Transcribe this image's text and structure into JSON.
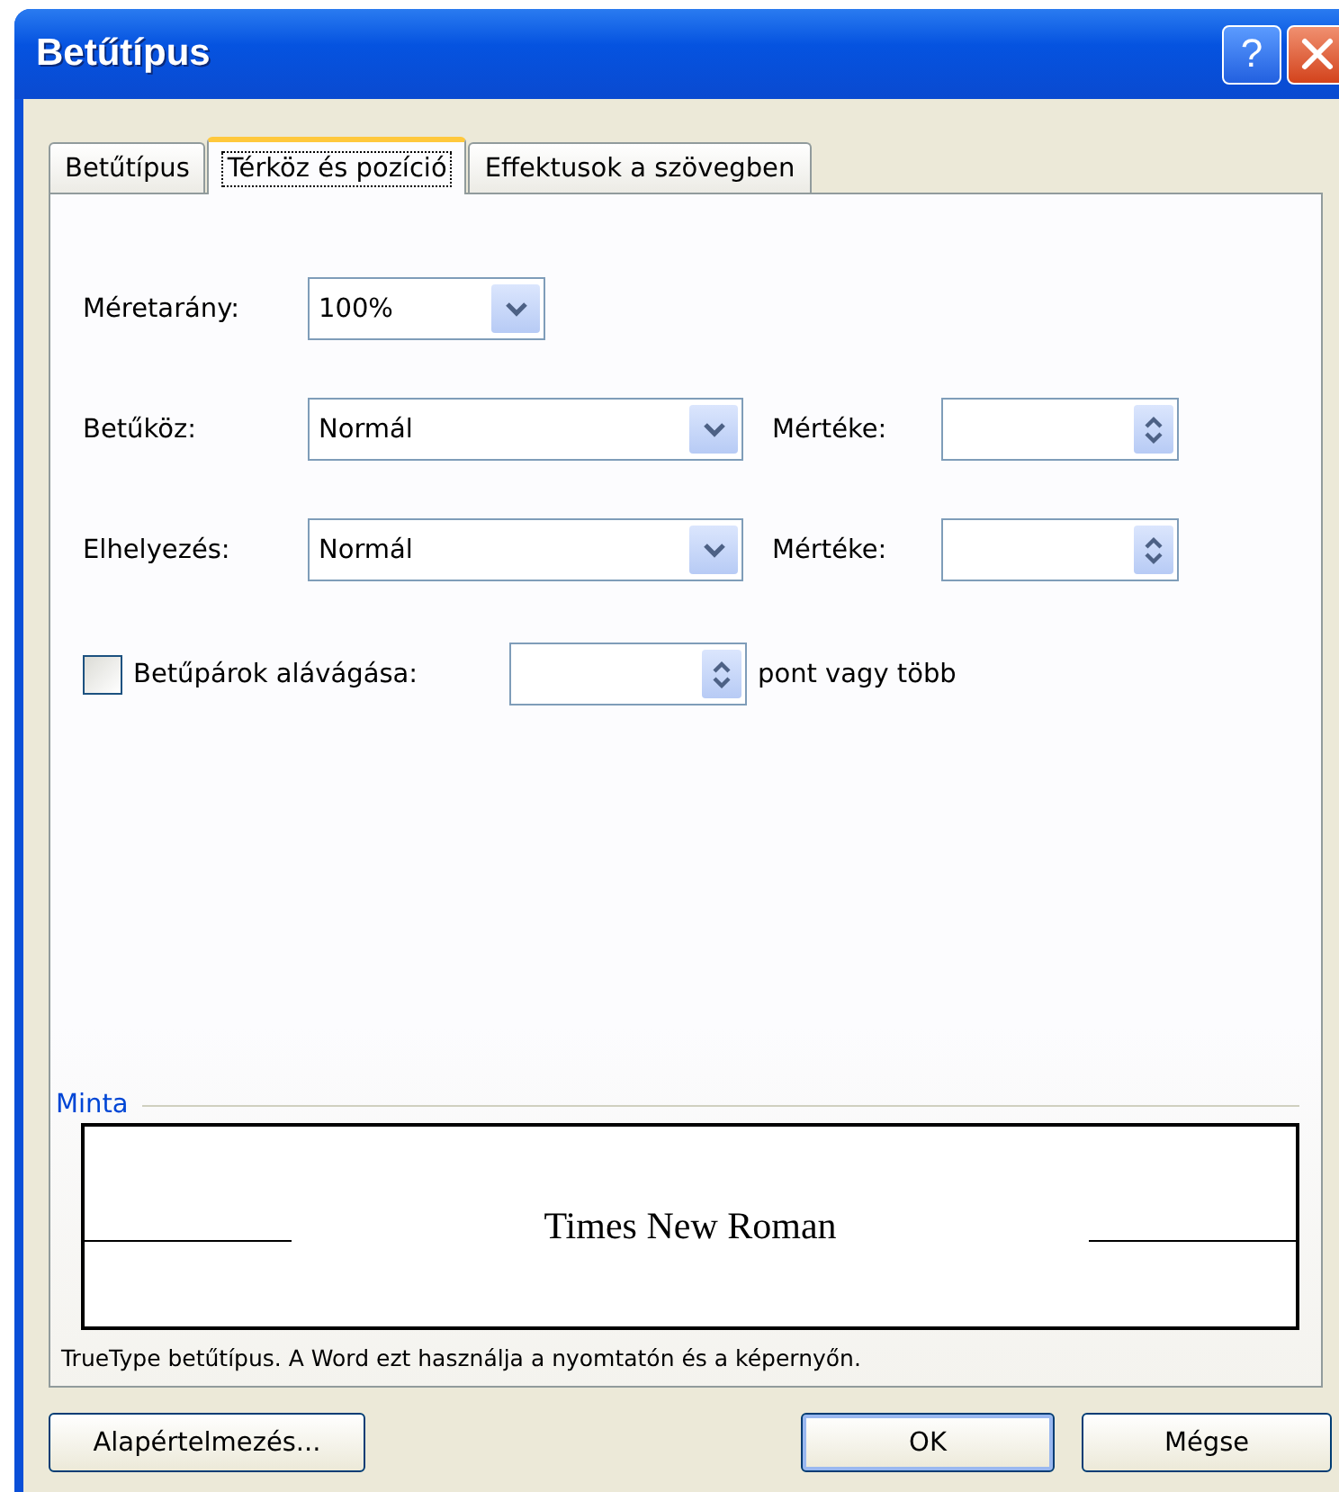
{
  "window": {
    "title": "Betűtípus",
    "help": "?"
  },
  "tabs": [
    {
      "label": "Betűtípus",
      "selected": false
    },
    {
      "label": "Térköz és pozíció",
      "selected": true
    },
    {
      "label": "Effektusok a szövegben",
      "selected": false
    }
  ],
  "scale": {
    "label": "Méretarány:",
    "value": "100%"
  },
  "rows": [
    {
      "label": "Betűköz:",
      "value": "Normál",
      "amount_label": "Mértéke:"
    },
    {
      "label": "Elhelyezés:",
      "value": "Normál",
      "amount_label": "Mértéke:"
    }
  ],
  "kerning": {
    "label": "Betűpárok alávágása:",
    "checked": false,
    "suffix": "pont vagy több"
  },
  "preview": {
    "legend": "Minta",
    "sample": "Times New Roman",
    "note": "TrueType betűtípus. A Word ezt használja a nyomtatón és a képernyőn."
  },
  "buttons": [
    {
      "label": "Alapértelmezés...",
      "default": false
    },
    {
      "label": "OK",
      "default": true
    },
    {
      "label": "Mégse",
      "default": false
    }
  ]
}
